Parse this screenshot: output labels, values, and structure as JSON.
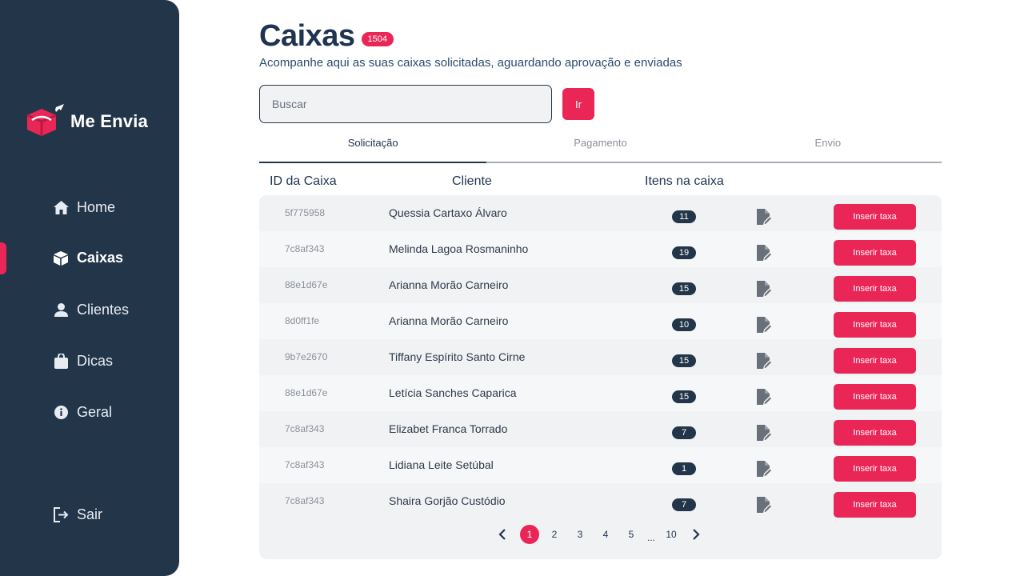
{
  "brand": {
    "name": "Me Envia",
    "accent": "#ea2657",
    "sidebar_bg": "#233549"
  },
  "sidebar": {
    "items": [
      {
        "label": "Home",
        "icon": "home-icon"
      },
      {
        "label": "Caixas",
        "icon": "box-icon",
        "active": true
      },
      {
        "label": "Clientes",
        "icon": "user-icon"
      },
      {
        "label": "Dicas",
        "icon": "bag-icon"
      },
      {
        "label": "Geral",
        "icon": "info-icon"
      }
    ],
    "logout": {
      "label": "Sair",
      "icon": "logout-icon"
    }
  },
  "header": {
    "title": "Caixas",
    "count": "1504",
    "subtitle": "Acompanhe aqui as suas caixas solicitadas, aguardando aprovação e enviadas"
  },
  "search": {
    "placeholder": "Buscar",
    "value": "",
    "button_label": "Ir"
  },
  "tabs": [
    {
      "label": "Solicitação",
      "active": true
    },
    {
      "label": "Pagamento",
      "active": false
    },
    {
      "label": "Envio",
      "active": false
    }
  ],
  "table": {
    "columns": [
      "ID da Caixa",
      "Cliente",
      "Itens na caixa"
    ],
    "action_label": "Inserir taxa",
    "rows": [
      {
        "id": "5f775958",
        "client": "Quessia Cartaxo Álvaro",
        "items": "11"
      },
      {
        "id": "7c8af343",
        "client": "Melinda Lagoa Rosmaninho",
        "items": "19"
      },
      {
        "id": "88e1d67e",
        "client": "Arianna Morão Carneiro",
        "items": "15"
      },
      {
        "id": "8d0ff1fe",
        "client": "Arianna Morão Carneiro",
        "items": "10"
      },
      {
        "id": "9b7e2670",
        "client": "Tiffany Espírito Santo Cirne",
        "items": "15"
      },
      {
        "id": "88e1d67e",
        "client": "Letícia Sanches Caparica",
        "items": "15"
      },
      {
        "id": "7c8af343",
        "client": "Elizabet Franca Torrado",
        "items": "7"
      },
      {
        "id": "7c8af343",
        "client": "Lidiana Leite Setúbal",
        "items": "1"
      },
      {
        "id": "7c8af343",
        "client": "Shaira Gorjão Custódio",
        "items": "7"
      }
    ]
  },
  "pagination": {
    "prev_icon": "chevron-left-icon",
    "next_icon": "chevron-right-icon",
    "pages": [
      "1",
      "2",
      "3",
      "4",
      "5",
      "...",
      "10"
    ],
    "current": "1"
  }
}
